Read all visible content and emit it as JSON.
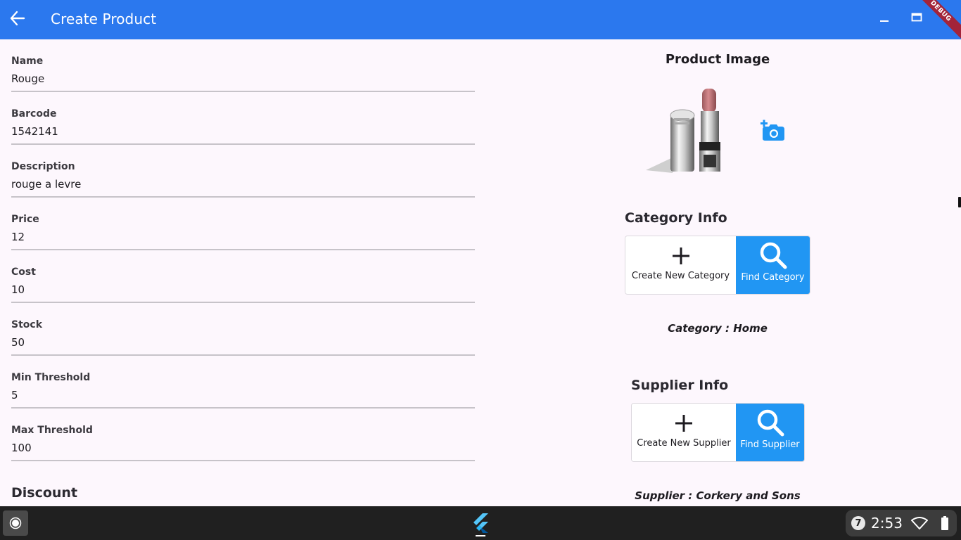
{
  "appbar": {
    "title": "Create Product",
    "debug_label": "DEBUG",
    "bg_color": "#2b78ee"
  },
  "form": {
    "fields": [
      {
        "label": "Name",
        "value": "Rouge"
      },
      {
        "label": "Barcode",
        "value": "1542141"
      },
      {
        "label": "Description",
        "value": "rouge a levre"
      },
      {
        "label": "Price",
        "value": "12"
      },
      {
        "label": "Cost",
        "value": "10"
      },
      {
        "label": "Stock",
        "value": "50"
      },
      {
        "label": "Min Threshold",
        "value": "5"
      },
      {
        "label": "Max Threshold",
        "value": "100"
      }
    ],
    "discount_title": "Discount"
  },
  "product_image": {
    "title": "Product Image",
    "image_icon": "lipstick-image",
    "add_photo_icon": "add-a-photo-icon"
  },
  "category": {
    "title": "Category Info",
    "create_label": "Create New Category",
    "find_label": "Find Category",
    "info": "Category : Home"
  },
  "supplier": {
    "title": "Supplier Info",
    "create_label": "Create New Supplier",
    "find_label": "Find Supplier",
    "info": "Supplier : Corkery and Sons"
  },
  "taskbar": {
    "notification_count": "7",
    "time": "2:53",
    "app_icon": "flutter-icon"
  },
  "colors": {
    "accent": "#2196f3",
    "background": "#fdf7fd"
  }
}
